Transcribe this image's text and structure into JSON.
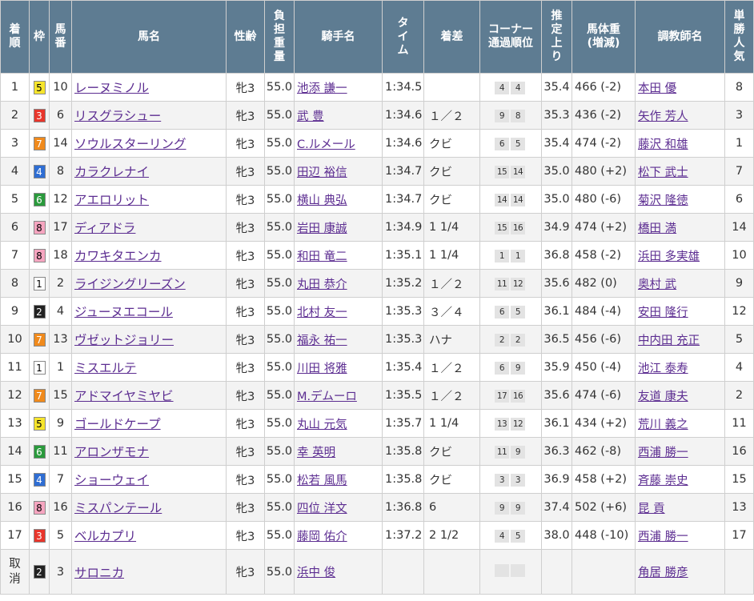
{
  "headers": {
    "rank": "着順",
    "waku": "枠",
    "umaban": "馬番",
    "horse": "馬名",
    "sexage": "性齢",
    "weight": "負担重量",
    "jockey": "騎手名",
    "time": "タイム",
    "margin": "着差",
    "corner": "コーナー通過順位",
    "last3f": "推定上り",
    "bodyweight": "馬体重(増減)",
    "trainer": "調教師名",
    "pop": "単勝人気"
  },
  "waku_colors": {
    "1": {
      "bg": "#ffffff",
      "fg": "#000000"
    },
    "2": {
      "bg": "#222222",
      "fg": "#ffffff"
    },
    "3": {
      "bg": "#e8352b",
      "fg": "#ffffff"
    },
    "4": {
      "bg": "#2f6ed3",
      "fg": "#ffffff"
    },
    "5": {
      "bg": "#f6e52c",
      "fg": "#000000"
    },
    "6": {
      "bg": "#2a9a3c",
      "fg": "#ffffff"
    },
    "7": {
      "bg": "#f08a1c",
      "fg": "#ffffff"
    },
    "8": {
      "bg": "#f6a5c0",
      "fg": "#000000"
    }
  },
  "rows": [
    {
      "rank": "1",
      "waku": "5",
      "umaban": "10",
      "horse": "レーヌミノル",
      "sexage": "牝3",
      "weight": "55.0",
      "jockey": "池添 謙一",
      "time": "1:34.5",
      "margin": "",
      "corner": [
        "4",
        "4"
      ],
      "last3f": "35.4",
      "bodyweight": "466 (-2)",
      "trainer": "本田 優",
      "pop": "8"
    },
    {
      "rank": "2",
      "waku": "3",
      "umaban": "6",
      "horse": "リスグラシュー",
      "sexage": "牝3",
      "weight": "55.0",
      "jockey": "武 豊",
      "time": "1:34.6",
      "margin": "１／２",
      "corner": [
        "9",
        "8"
      ],
      "last3f": "35.3",
      "bodyweight": "436 (-2)",
      "trainer": "矢作 芳人",
      "pop": "3"
    },
    {
      "rank": "3",
      "waku": "7",
      "umaban": "14",
      "horse": "ソウルスターリング",
      "sexage": "牝3",
      "weight": "55.0",
      "jockey": "C.ルメール",
      "time": "1:34.6",
      "margin": "クビ",
      "corner": [
        "6",
        "5"
      ],
      "last3f": "35.4",
      "bodyweight": "474 (-2)",
      "trainer": "藤沢 和雄",
      "pop": "1"
    },
    {
      "rank": "4",
      "waku": "4",
      "umaban": "8",
      "horse": "カラクレナイ",
      "sexage": "牝3",
      "weight": "55.0",
      "jockey": "田辺 裕信",
      "time": "1:34.7",
      "margin": "クビ",
      "corner": [
        "15",
        "14"
      ],
      "last3f": "35.0",
      "bodyweight": "480 (+2)",
      "trainer": "松下 武士",
      "pop": "7"
    },
    {
      "rank": "5",
      "waku": "6",
      "umaban": "12",
      "horse": "アエロリット",
      "sexage": "牝3",
      "weight": "55.0",
      "jockey": "横山 典弘",
      "time": "1:34.7",
      "margin": "クビ",
      "corner": [
        "14",
        "14"
      ],
      "last3f": "35.0",
      "bodyweight": "480 (-6)",
      "trainer": "菊沢 隆徳",
      "pop": "6"
    },
    {
      "rank": "6",
      "waku": "8",
      "umaban": "17",
      "horse": "ディアドラ",
      "sexage": "牝3",
      "weight": "55.0",
      "jockey": "岩田 康誠",
      "time": "1:34.9",
      "margin": "1 1/4",
      "corner": [
        "15",
        "16"
      ],
      "last3f": "34.9",
      "bodyweight": "474 (+2)",
      "trainer": "橋田 満",
      "pop": "14"
    },
    {
      "rank": "7",
      "waku": "8",
      "umaban": "18",
      "horse": "カワキタエンカ",
      "sexage": "牝3",
      "weight": "55.0",
      "jockey": "和田 竜二",
      "time": "1:35.1",
      "margin": "1 1/4",
      "corner": [
        "1",
        "1"
      ],
      "last3f": "36.8",
      "bodyweight": "458 (-2)",
      "trainer": "浜田 多実雄",
      "pop": "10"
    },
    {
      "rank": "8",
      "waku": "1",
      "umaban": "2",
      "horse": "ライジングリーズン",
      "sexage": "牝3",
      "weight": "55.0",
      "jockey": "丸田 恭介",
      "time": "1:35.2",
      "margin": "１／２",
      "corner": [
        "11",
        "12"
      ],
      "last3f": "35.6",
      "bodyweight": "482 (0)",
      "trainer": "奥村 武",
      "pop": "9"
    },
    {
      "rank": "9",
      "waku": "2",
      "umaban": "4",
      "horse": "ジューヌエコール",
      "sexage": "牝3",
      "weight": "55.0",
      "jockey": "北村 友一",
      "time": "1:35.3",
      "margin": "３／４",
      "corner": [
        "6",
        "5"
      ],
      "last3f": "36.1",
      "bodyweight": "484 (-4)",
      "trainer": "安田 隆行",
      "pop": "12"
    },
    {
      "rank": "10",
      "waku": "7",
      "umaban": "13",
      "horse": "ヴゼットジョリー",
      "sexage": "牝3",
      "weight": "55.0",
      "jockey": "福永 祐一",
      "time": "1:35.3",
      "margin": "ハナ",
      "corner": [
        "2",
        "2"
      ],
      "last3f": "36.5",
      "bodyweight": "456 (-6)",
      "trainer": "中内田 充正",
      "pop": "5"
    },
    {
      "rank": "11",
      "waku": "1",
      "umaban": "1",
      "horse": "ミスエルテ",
      "sexage": "牝3",
      "weight": "55.0",
      "jockey": "川田 将雅",
      "time": "1:35.4",
      "margin": "１／２",
      "corner": [
        "6",
        "9"
      ],
      "last3f": "35.9",
      "bodyweight": "450 (-4)",
      "trainer": "池江 泰寿",
      "pop": "4"
    },
    {
      "rank": "12",
      "waku": "7",
      "umaban": "15",
      "horse": "アドマイヤミヤビ",
      "sexage": "牝3",
      "weight": "55.0",
      "jockey": "M.デムーロ",
      "time": "1:35.5",
      "margin": "１／２",
      "corner": [
        "17",
        "16"
      ],
      "last3f": "35.6",
      "bodyweight": "474 (-6)",
      "trainer": "友道 康夫",
      "pop": "2"
    },
    {
      "rank": "13",
      "waku": "5",
      "umaban": "9",
      "horse": "ゴールドケープ",
      "sexage": "牝3",
      "weight": "55.0",
      "jockey": "丸山 元気",
      "time": "1:35.7",
      "margin": "1 1/4",
      "corner": [
        "13",
        "12"
      ],
      "last3f": "36.1",
      "bodyweight": "434 (+2)",
      "trainer": "荒川 義之",
      "pop": "11"
    },
    {
      "rank": "14",
      "waku": "6",
      "umaban": "11",
      "horse": "アロンザモナ",
      "sexage": "牝3",
      "weight": "55.0",
      "jockey": "幸 英明",
      "time": "1:35.8",
      "margin": "クビ",
      "corner": [
        "11",
        "9"
      ],
      "last3f": "36.3",
      "bodyweight": "462 (-8)",
      "trainer": "西浦 勝一",
      "pop": "16"
    },
    {
      "rank": "15",
      "waku": "4",
      "umaban": "7",
      "horse": "ショーウェイ",
      "sexage": "牝3",
      "weight": "55.0",
      "jockey": "松若 風馬",
      "time": "1:35.8",
      "margin": "クビ",
      "corner": [
        "3",
        "3"
      ],
      "last3f": "36.9",
      "bodyweight": "458 (+2)",
      "trainer": "斉藤 崇史",
      "pop": "15"
    },
    {
      "rank": "16",
      "waku": "8",
      "umaban": "16",
      "horse": "ミスパンテール",
      "sexage": "牝3",
      "weight": "55.0",
      "jockey": "四位 洋文",
      "time": "1:36.8",
      "margin": "6",
      "corner": [
        "9",
        "9"
      ],
      "last3f": "37.4",
      "bodyweight": "502 (+6)",
      "trainer": "昆 貢",
      "pop": "13"
    },
    {
      "rank": "17",
      "waku": "3",
      "umaban": "5",
      "horse": "ベルカプリ",
      "sexage": "牝3",
      "weight": "55.0",
      "jockey": "藤岡 佑介",
      "time": "1:37.2",
      "margin": "2 1/2",
      "corner": [
        "4",
        "5"
      ],
      "last3f": "38.0",
      "bodyweight": "448 (-10)",
      "trainer": "西浦 勝一",
      "pop": "17"
    },
    {
      "rank": "取消",
      "waku": "2",
      "umaban": "3",
      "horse": "サロニカ",
      "sexage": "牝3",
      "weight": "55.0",
      "jockey": "浜中 俊",
      "time": "",
      "margin": "",
      "corner": [
        "",
        ""
      ],
      "last3f": "",
      "bodyweight": "",
      "trainer": "角居 勝彦",
      "pop": "",
      "scratch": true
    }
  ]
}
